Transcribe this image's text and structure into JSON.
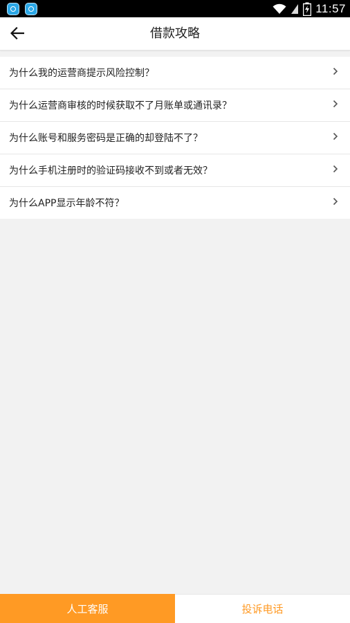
{
  "status_bar": {
    "time": "11:57",
    "icons": [
      "app-notification-icon",
      "app-notification-icon",
      "wifi-icon",
      "signal-icon",
      "battery-charging-icon"
    ]
  },
  "header": {
    "title": "借款攻略",
    "back_icon": "arrow-left-icon"
  },
  "faq": {
    "items": [
      {
        "label": "为什么我的运营商提示风险控制？"
      },
      {
        "label": "为什么运营商审核的时候获取不了月账单或通讯录？"
      },
      {
        "label": "为什么账号和服务密码是正确的却登陆不了？"
      },
      {
        "label": "为什么手机注册时的验证码接收不到或者无效？"
      },
      {
        "label": "为什么APP显示年龄不符？"
      }
    ],
    "chevron_icon": "chevron-right-icon"
  },
  "bottom_bar": {
    "service_label": "人工客服",
    "complaint_label": "投诉电话"
  },
  "colors": {
    "accent": "#ff9a24",
    "background": "#f2f2f2",
    "status_bar": "#000000"
  }
}
